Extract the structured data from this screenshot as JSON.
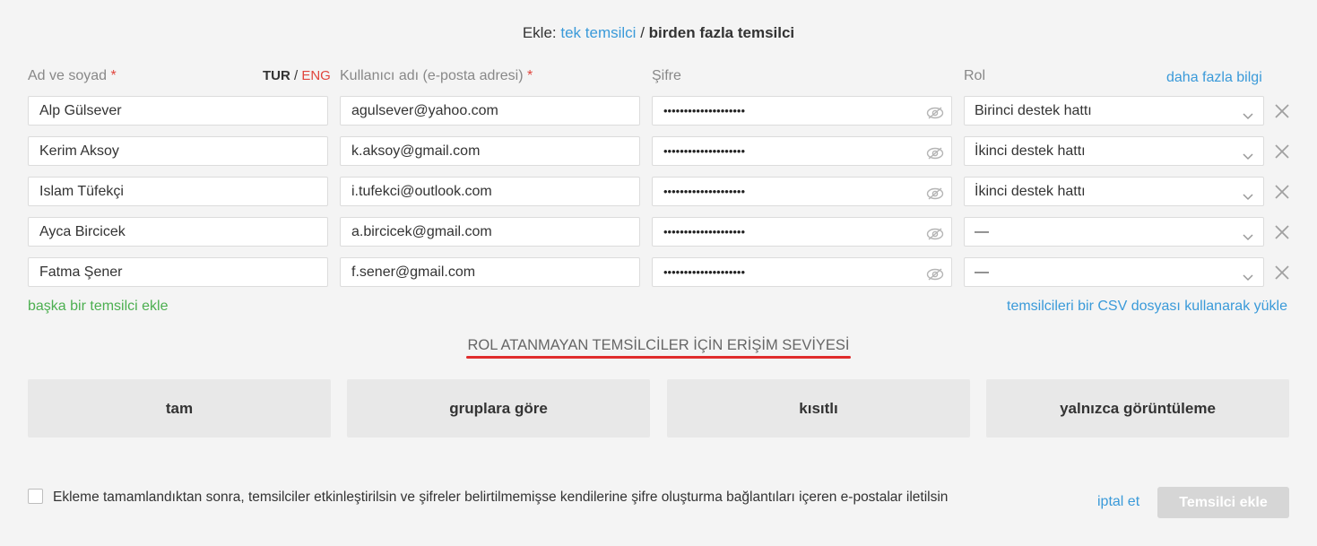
{
  "header": {
    "prefix": "Ekle:",
    "single_link": "tek temsilci",
    "separator": "/",
    "multiple_label": "birden fazla temsilci"
  },
  "columns": {
    "name_label": "Ad ve soyad",
    "name_required": "*",
    "lang_active": "TUR",
    "lang_sep": "/",
    "lang_inactive": "ENG",
    "email_label": "Kullanıcı adı (e-posta adresi)",
    "email_required": "*",
    "password_label": "Şifre",
    "role_label": "Rol",
    "more_info": "daha fazla bilgi"
  },
  "rows": [
    {
      "name": "Alp Gülsever",
      "email": "agulsever@yahoo.com",
      "password": "••••••••••••••••••••",
      "role": "Birinci destek hattı"
    },
    {
      "name": "Kerim Aksoy",
      "email": "k.aksoy@gmail.com",
      "password": "••••••••••••••••••••",
      "role": "İkinci destek hattı"
    },
    {
      "name": "Islam Tüfekçi",
      "email": "i.tufekci@outlook.com",
      "password": "••••••••••••••••••••",
      "role": "İkinci destek hattı"
    },
    {
      "name": "Ayca Bircicek",
      "email": "a.bircicek@gmail.com",
      "password": "••••••••••••••••••••",
      "role": "—"
    },
    {
      "name": "Fatma Şener",
      "email": "f.sener@gmail.com",
      "password": "••••••••••••••••••••",
      "role": "—"
    }
  ],
  "links": {
    "add_another": "başka bir temsilci ekle",
    "csv_upload": "temsilcileri bir CSV dosyası kullanarak yükle"
  },
  "access": {
    "title": "ROL ATANMAYAN TEMSİLCİLER İÇİN ERİŞİM SEVİYESİ",
    "options": [
      "tam",
      "gruplara göre",
      "kısıtlı",
      "yalnızca görüntüleme"
    ]
  },
  "footer": {
    "checkbox_label": "Ekleme tamamlandıktan sonra, temsilciler etkinleştirilsin ve şifreler belirtilmemişse kendilerine şifre oluşturma bağlantıları içeren e-postalar iletilsin",
    "checked": false,
    "cancel": "iptal et",
    "submit": "Temsilci ekle"
  },
  "colors": {
    "link": "#3a9ad9",
    "success_link": "#4caf50",
    "required": "#e0453d",
    "underline": "#e02c2c",
    "disabled_button": "#d6d6d6"
  },
  "icons": {
    "password_toggle": "eye-icon",
    "role_dropdown": "chevron-down-icon",
    "row_remove": "close-icon"
  }
}
